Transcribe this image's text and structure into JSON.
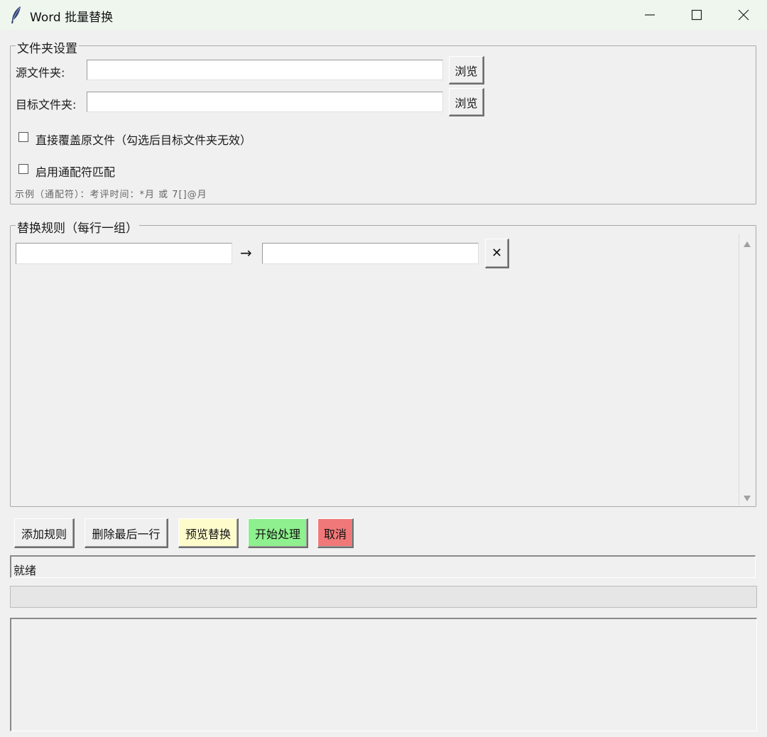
{
  "window": {
    "title": "Word 批量替换",
    "icon": "feather-icon"
  },
  "folder_settings": {
    "group_label": "文件夹设置",
    "source_label": "源文件夹:",
    "source_value": "",
    "target_label": "目标文件夹:",
    "target_value": "",
    "browse_label": "浏览",
    "overwrite_label": "直接覆盖原文件（勾选后目标文件夹无效）",
    "overwrite_checked": false,
    "wildcard_label": "启用通配符匹配",
    "wildcard_checked": false,
    "wildcard_hint": "示例（通配符）：考评时间：*月  或  7[]@月"
  },
  "rules": {
    "group_label": "替换规则（每行一组）",
    "arrow": "→",
    "remove_glyph": "✕",
    "items": [
      {
        "find": "",
        "replace": ""
      }
    ]
  },
  "actions": {
    "add_rule": "添加规则",
    "delete_last": "删除最后一行",
    "preview": "预览替换",
    "start": "开始处理",
    "cancel": "取消"
  },
  "colors": {
    "preview_bg": "#fffccc",
    "start_bg": "#8ef08e",
    "cancel_bg": "#f07878"
  },
  "status": {
    "text": "就绪",
    "progress": 0
  },
  "log": {
    "text": ""
  }
}
